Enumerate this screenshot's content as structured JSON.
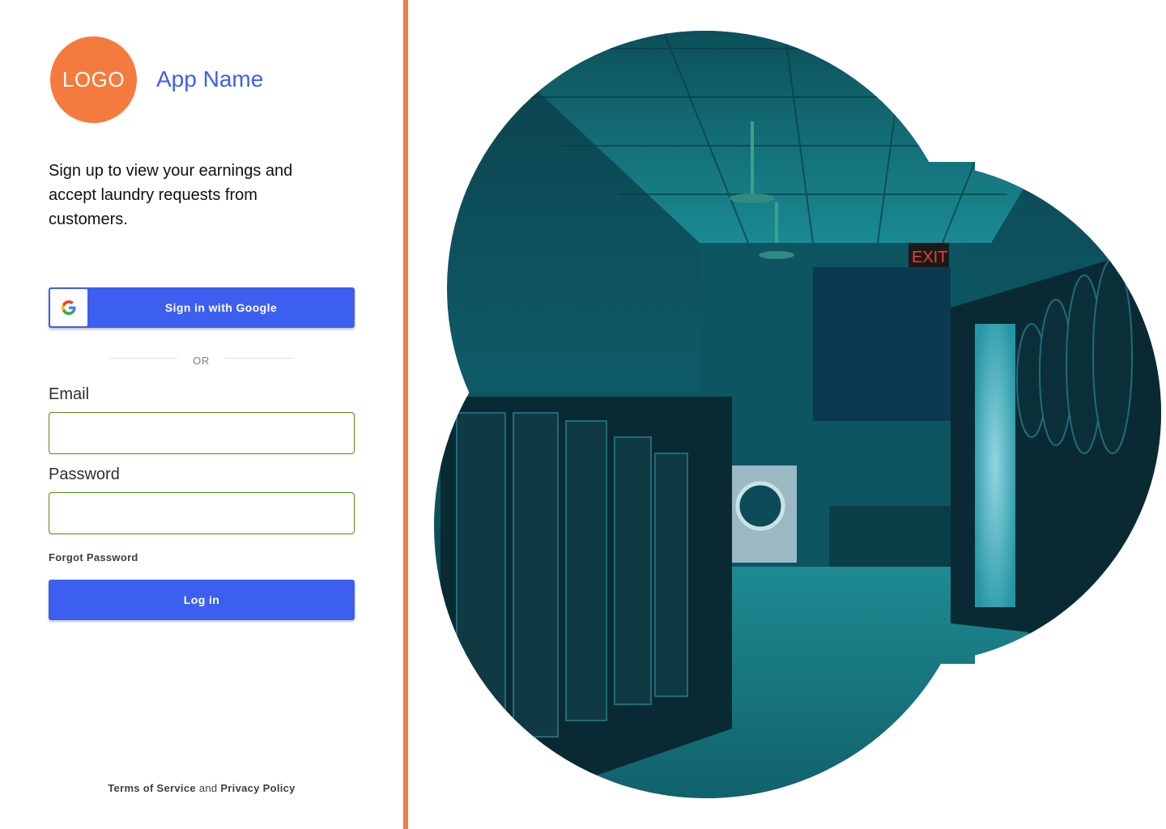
{
  "brand": {
    "logo_text": "LOGO",
    "app_name": "App Name",
    "accent_color": "#f47b3e",
    "primary_color": "#3d5ff0"
  },
  "tagline": "Sign up to view your earnings and accept laundry requests from customers.",
  "google_signin": {
    "label": "Sign in with Google",
    "icon": "google-g-icon"
  },
  "separator": {
    "text": "OR"
  },
  "form": {
    "email": {
      "label": "Email",
      "value": "",
      "placeholder": ""
    },
    "password": {
      "label": "Password",
      "value": "",
      "placeholder": ""
    },
    "forgot_password": "Forgot Password",
    "login_label": "Log in"
  },
  "footer": {
    "terms": "Terms of Service",
    "conjunction": "and",
    "privacy": "Privacy Policy"
  },
  "hero_image": {
    "subject": "laundromat-interior",
    "sign_text": "EXIT"
  }
}
